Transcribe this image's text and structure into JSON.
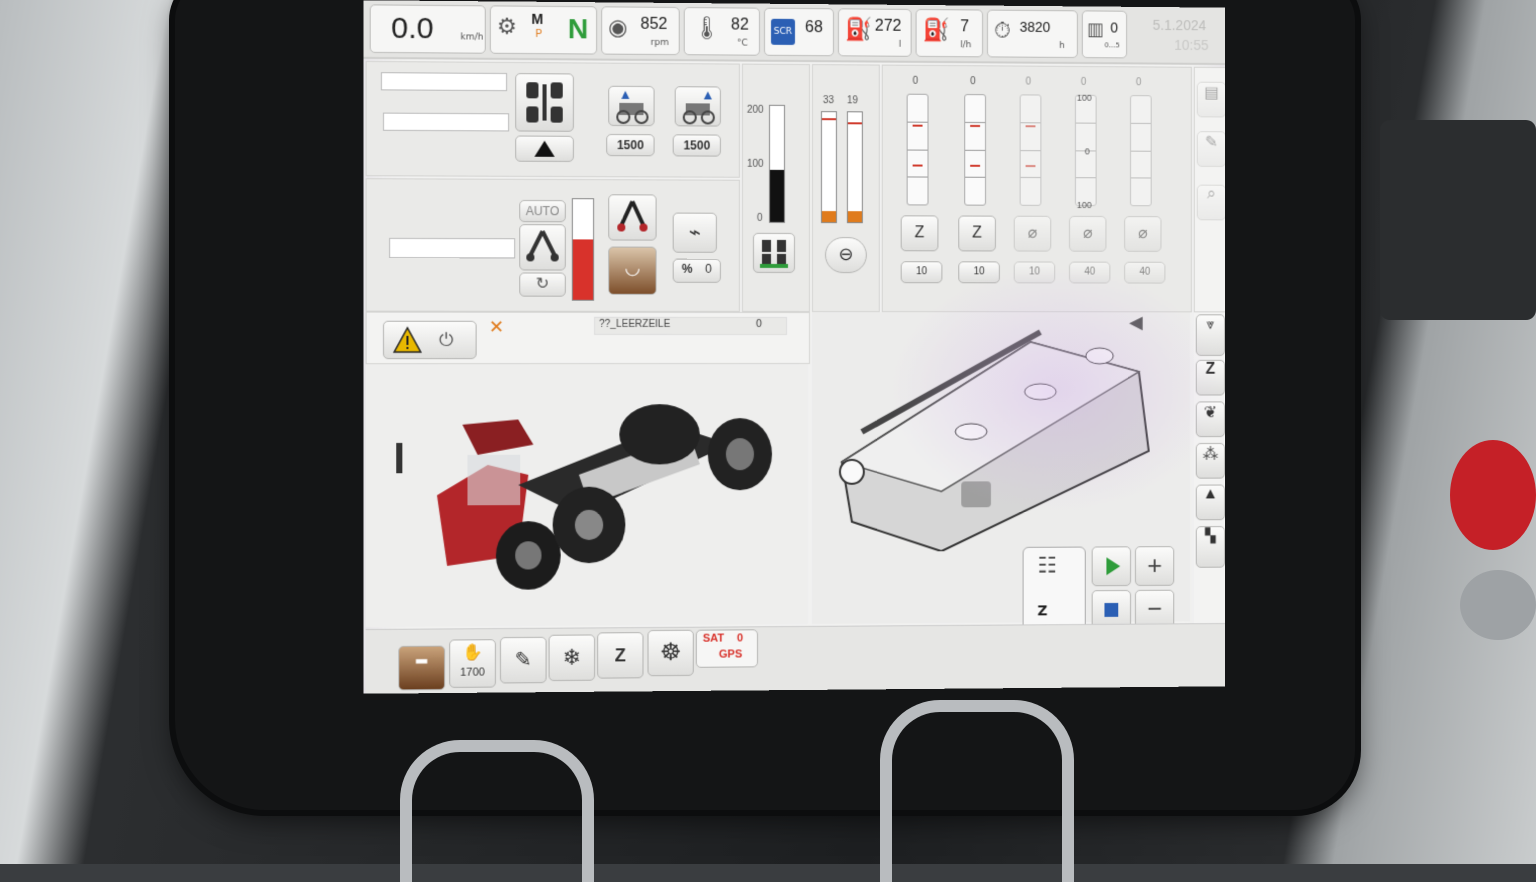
{
  "colors": {
    "accent_green": "#2e9c3a",
    "warning": "#e8b800",
    "tractor_red": "#b3262a",
    "sat_red": "#d8322b"
  },
  "status_bar": {
    "speed": "0.0",
    "speed_unit": "km/h",
    "transmission_mode": "M",
    "transmission_sub": "P",
    "gear": "N",
    "engine_rpm": "852",
    "engine_rpm_unit": "rpm",
    "coolant_temp": "82",
    "coolant_temp_unit": "°C",
    "scr_level": "68",
    "fuel_level": "272",
    "fuel_unit": "l",
    "fuel_rate": "7",
    "fuel_rate_unit": "l/h",
    "engine_hours": "3820",
    "engine_hours_unit": "h",
    "filter_value": "0",
    "filter_unit": "0...5",
    "date": "5.1.2024",
    "time": "10:55"
  },
  "drive_panel": {
    "pto_front_rpm": "1500",
    "pto_rear_rpm": "1500",
    "auto_label": "AUTO",
    "percent_label": "%",
    "percent_value": "0"
  },
  "scales": {
    "gauge_max": "200",
    "gauge_mid": "100",
    "gauge_min": "0",
    "gauge_level": 0.45,
    "bar_a_value": "33",
    "bar_b_value": "19",
    "bar_a_level": 0.1,
    "bar_b_level": 0.1
  },
  "valves": {
    "top_values": [
      "0",
      "0",
      "0",
      "0",
      "0"
    ],
    "scale_top": "100",
    "scale_mid": "0",
    "scale_bottom": "100",
    "flow_values": [
      "10",
      "10",
      "10",
      "40",
      "40"
    ]
  },
  "messages": {
    "line_text": "??_LEERZEILE",
    "line_count": "0"
  },
  "bottom_bar": {
    "hitch_rpm": "1700",
    "sat_label": "SAT",
    "sat_value": "0",
    "gps_label": "GPS"
  },
  "icons": [
    "gear-icon",
    "engine-icon",
    "thermometer-icon",
    "scr-tank-icon",
    "fuel-pump-icon",
    "clock-icon",
    "filter-icon",
    "warning-icon",
    "play-icon",
    "plus-icon",
    "stop-icon",
    "minus-icon",
    "steering-wheel-icon",
    "snowflake-icon",
    "back-arrow-icon"
  ]
}
